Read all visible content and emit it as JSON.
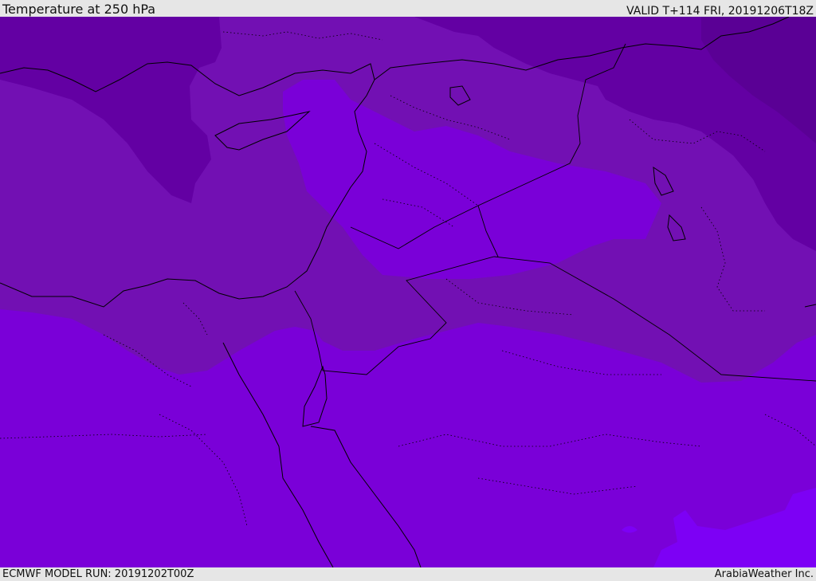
{
  "header": {
    "title": "Temperature at 250 hPa",
    "valid": "VALID T+114 FRI, 20191206T18Z"
  },
  "footer": {
    "model_run": "ECMWF MODEL RUN: 20191202T00Z",
    "credit": "ArabiaWeather Inc."
  },
  "colors": {
    "frame": "#e6e6e6",
    "band_coldest": "#5a0095",
    "band_cold": "#6300a3",
    "band_mid": "#7210b3",
    "band_warm": "#7a00d8",
    "band_warmest": "#7d00f5",
    "border": "#000000"
  }
}
